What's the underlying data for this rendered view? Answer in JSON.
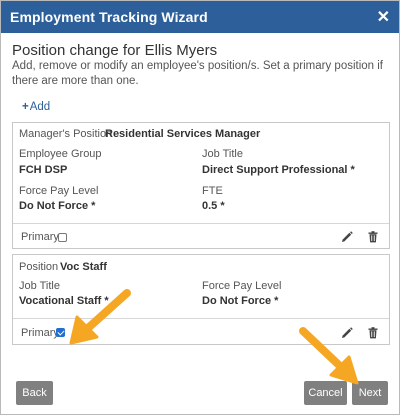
{
  "dialog": {
    "title": "Employment Tracking Wizard",
    "close_icon": "close-icon",
    "heading": "Position change for Ellis Myers",
    "instructions": "Add, remove or modify an employee's position/s. Set a primary position if there are more than one.",
    "add_label": "Add"
  },
  "positions": [
    {
      "header_label": "Manager's Position",
      "header_value": "Residential Services Manager",
      "fields": {
        "employee_group_label": "Employee Group",
        "employee_group_value": "FCH DSP",
        "job_title_label": "Job Title",
        "job_title_value": "Direct Support Professional *",
        "force_pay_label": "Force Pay Level",
        "force_pay_value": "Do Not Force *",
        "fte_label": "FTE",
        "fte_value": "0.5 *"
      },
      "primary_label": "Primary",
      "primary_checked": false
    },
    {
      "header_label": "Position",
      "header_value": "Voc Staff",
      "fields": {
        "job_title_label": "Job Title",
        "job_title_value": "Vocational Staff *",
        "force_pay_label": "Force Pay Level",
        "force_pay_value": "Do Not Force *"
      },
      "primary_label": "Primary",
      "primary_checked": true
    }
  ],
  "buttons": {
    "back": "Back",
    "cancel": "Cancel",
    "next": "Next"
  },
  "colors": {
    "titlebar": "#2d5f9a",
    "button": "#808080",
    "annotation_arrow": "#f5a623",
    "checkbox_checked": "#1f6fd1"
  }
}
